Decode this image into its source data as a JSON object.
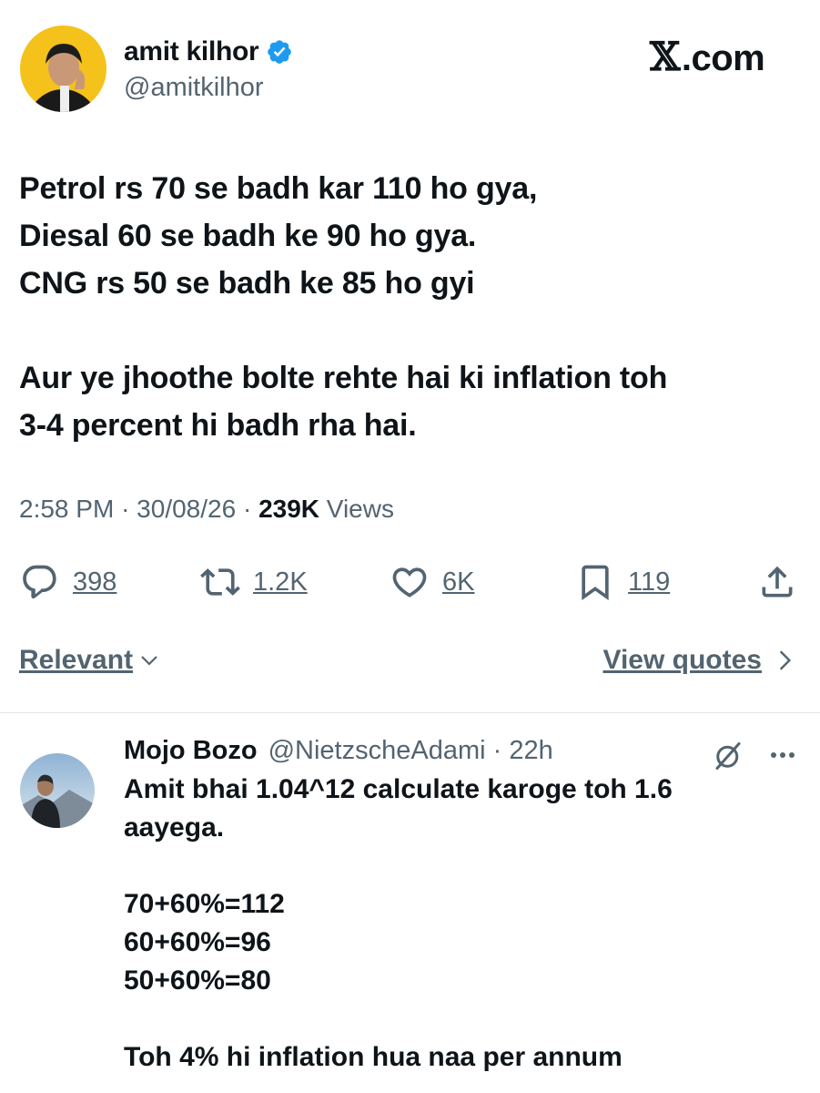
{
  "author": {
    "name": "amit kilhor",
    "handle": "@amitkilhor",
    "verified": true,
    "avatar_icon": "avatar-photo"
  },
  "site": {
    "logo_mark": "𝕏",
    "label": ".com"
  },
  "tweet": {
    "lines": [
      "Petrol rs 70 se badh kar 110 ho gya,",
      "Diesal 60 se badh ke 90 ho gya.",
      "CNG rs 50 se badh ke 85 ho gyi",
      "",
      "Aur ye jhoothe bolte rehte hai ki inflation toh",
      "3-4 percent hi badh rha hai."
    ],
    "time": "2:58 PM",
    "date": "30/08/26",
    "views_count": "239K",
    "views_label": "Views"
  },
  "actions": {
    "replies": "398",
    "reposts": "1.2K",
    "likes": "6K",
    "bookmarks": "119"
  },
  "filters": {
    "sort_label": "Relevant",
    "view_quotes_label": "View quotes"
  },
  "reply": {
    "name": "Mojo Bozo",
    "handle": "@NietzscheAdami",
    "time": "22h",
    "lines": [
      "Amit bhai 1.04^12 calculate karoge toh 1.6",
      "aayega.",
      "",
      "70+60%=112",
      "60+60%=96",
      "50+60%=80",
      "",
      "Toh 4% hi inflation hua naa per annum"
    ]
  },
  "colors": {
    "text": "#0f1419",
    "secondary": "#536471",
    "verified": "#1d9bf0",
    "divider": "#e1e6ea"
  }
}
